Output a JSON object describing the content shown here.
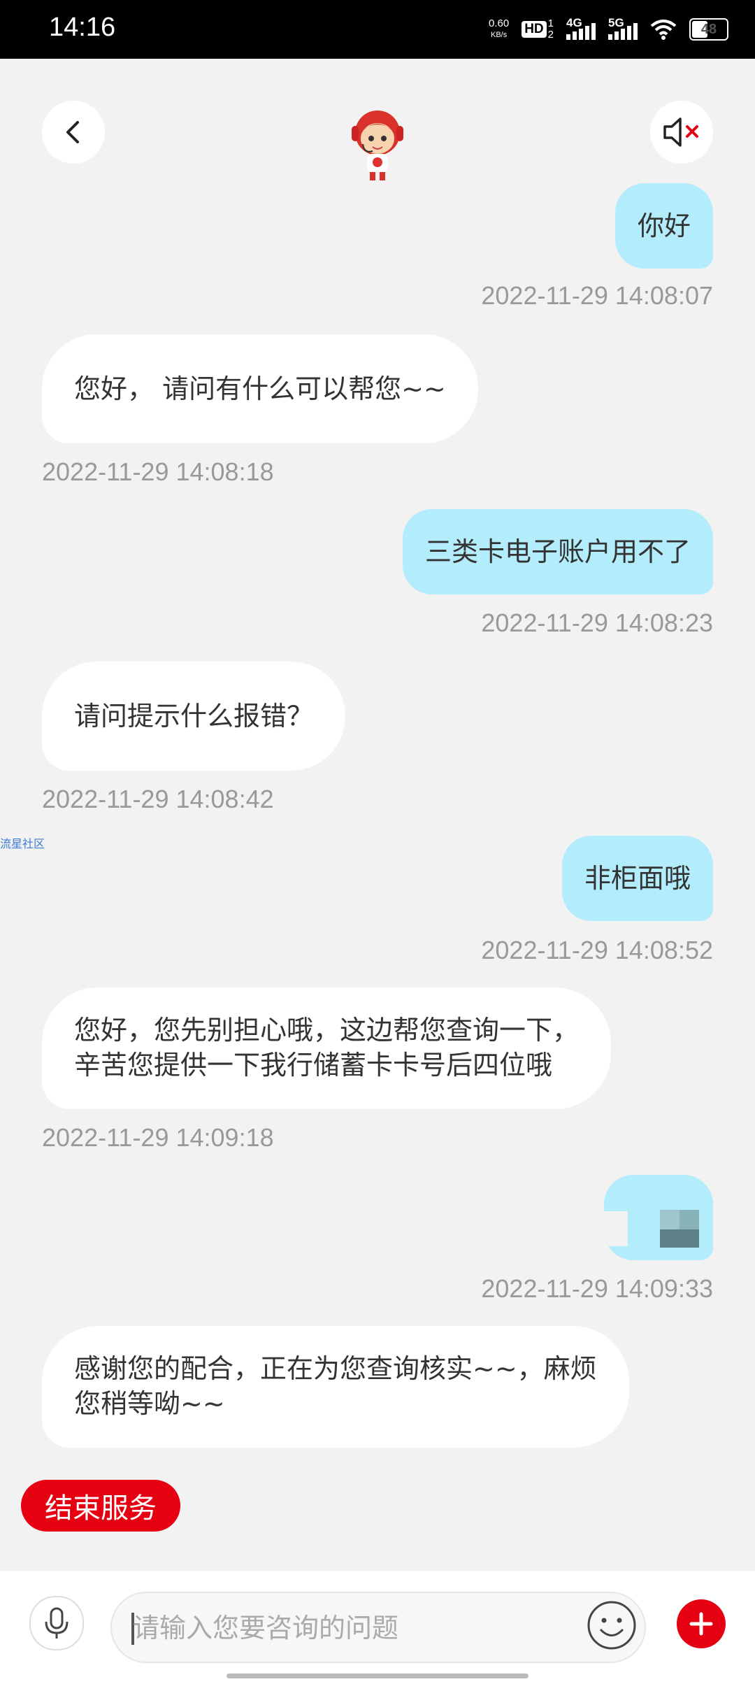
{
  "status_bar": {
    "time": "14:16",
    "net_speed_value": "0.60",
    "net_speed_unit": "KB/s",
    "hd_badge": "HD",
    "hd_sub_1": "1",
    "hd_sub_2": "2",
    "signal_1_label": "4G",
    "signal_2_label": "5G",
    "battery": "48"
  },
  "header": {
    "back_icon": "chevron-left-icon",
    "mascot": "customer-service-mascot",
    "mute_icon": "speaker-muted-icon"
  },
  "messages": [
    {
      "from": "user",
      "text": "你好",
      "time": "2022-11-29 14:08:07"
    },
    {
      "from": "agent",
      "text": "您好， 请问有什么可以帮您~~",
      "time": "2022-11-29 14:08:18"
    },
    {
      "from": "user",
      "text": "三类卡电子账户用不了",
      "time": "2022-11-29 14:08:23"
    },
    {
      "from": "agent",
      "text": "请问提示什么报错？",
      "time": "2022-11-29 14:08:42"
    },
    {
      "from": "user",
      "text": "非柜面哦",
      "time": "2022-11-29 14:08:52"
    },
    {
      "from": "agent",
      "lines": [
        "您好，您先别担心哦，这边帮您查询一下，",
        "辛苦您提供一下我行储蓄卡卡号后四位哦"
      ],
      "time": "2022-11-29 14:09:18"
    },
    {
      "from": "user",
      "text": "",
      "redacted": true,
      "time": "2022-11-29 14:09:33"
    },
    {
      "from": "agent",
      "lines": [
        "感谢您的配合，正在为您查询核实~~，麻烦",
        "您稍等呦~~"
      ]
    }
  ],
  "watermark": "流星社区",
  "end_service_label": "结束服务",
  "input": {
    "placeholder": "请输入您要咨询的问题",
    "value": ""
  },
  "colors": {
    "user_bubble": "#b3ecfb",
    "agent_bubble": "#ffffff",
    "accent_red": "#e50012",
    "background": "#f2f2f2"
  }
}
